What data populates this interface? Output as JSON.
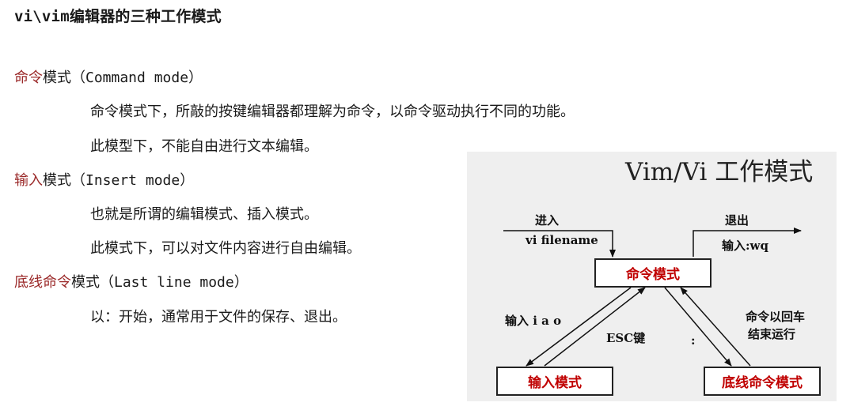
{
  "title": "vi\\vim编辑器的三种工作模式",
  "modes": [
    {
      "name": "命令",
      "suffix": "模式（Command mode）",
      "lines": [
        "命令模式下，所敲的按键编辑器都理解为命令，以命令驱动执行不同的功能。",
        "此模型下，不能自由进行文本编辑。"
      ]
    },
    {
      "name": "输入",
      "suffix": "模式（Insert mode）",
      "lines": [
        "也就是所谓的编辑模式、插入模式。",
        "此模式下，可以对文件内容进行自由编辑。"
      ]
    },
    {
      "name": "底线命令",
      "suffix": "模式（Last line mode）",
      "lines": [
        "以：开始，通常用于文件的保存、退出。"
      ]
    }
  ],
  "diagram": {
    "title": "Vim/Vi 工作模式",
    "enter_label": "进入",
    "enter_cmd": "vi filename",
    "exit_label": "退出",
    "exit_cmd": "输入:wq",
    "command_box": "命令模式",
    "insert_box": "输入模式",
    "lastline_box": "底线命令模式",
    "to_insert": "输入 i a o",
    "esc": "ESC键",
    "colon": ":",
    "enter_run_1": "命令以回车",
    "enter_run_2": "结束运行"
  }
}
